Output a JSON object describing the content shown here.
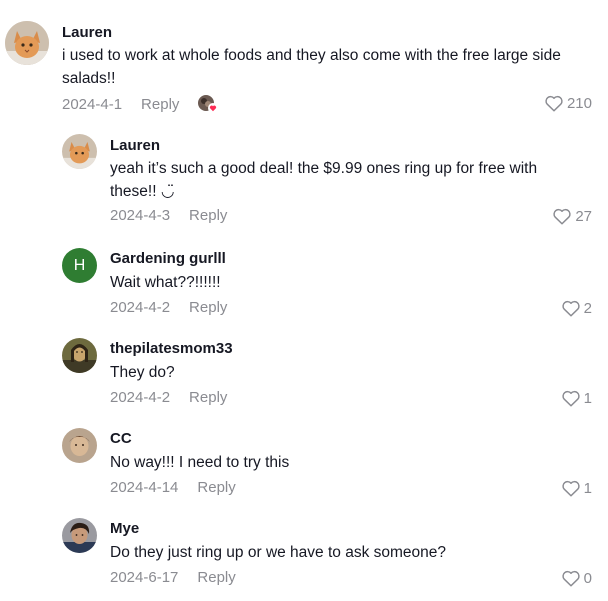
{
  "comments": [
    {
      "username": "Lauren",
      "text": "i used to work at whole foods and they also come with the free large side salads!!",
      "date": "2024-4-1",
      "reply_label": "Reply",
      "likes": "210",
      "creator_liked": true
    },
    {
      "username": "Lauren",
      "text": "yeah it’s such a good deal! the $9.99 ones ring up for free with these!! ◡̈",
      "date": "2024-4-3",
      "reply_label": "Reply",
      "likes": "27"
    },
    {
      "username": "Gardening gurlll",
      "text": "Wait what??!!!!!!",
      "date": "2024-4-2",
      "reply_label": "Reply",
      "likes": "2",
      "avatar_letter": "H"
    },
    {
      "username": "thepilatesmom33",
      "text": "They do?",
      "date": "2024-4-2",
      "reply_label": "Reply",
      "likes": "1"
    },
    {
      "username": "CC",
      "text": "No way!!! I need to try this",
      "date": "2024-4-14",
      "reply_label": "Reply",
      "likes": "1"
    },
    {
      "username": "Mye",
      "text": "Do they just ring up or we have to ask someone?",
      "date": "2024-6-17",
      "reply_label": "Reply",
      "likes": "0"
    }
  ],
  "icons": {
    "like": "heart-outline-icon",
    "creator_liked": "creator-liked-badge-icon"
  },
  "colors": {
    "username": "#161823",
    "meta": "#8a8b91",
    "creator_heart": "#fe2c55",
    "letter_avatar_bg": "#2f7d32"
  }
}
